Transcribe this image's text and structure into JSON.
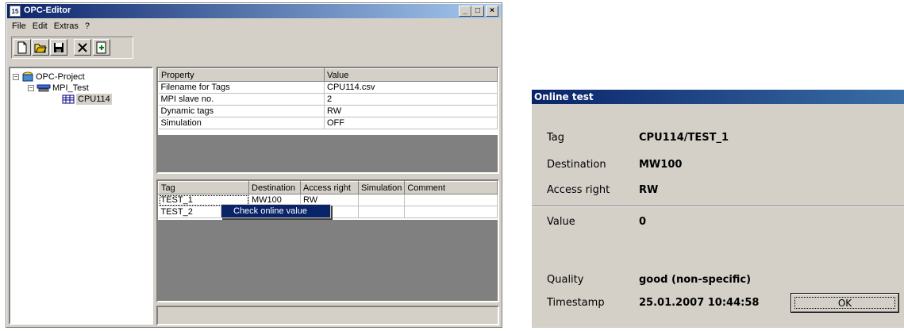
{
  "editor": {
    "title": "OPC-Editor",
    "app_icon_text": "15",
    "menu": [
      "File",
      "Edit",
      "Extras",
      "?"
    ],
    "tree": {
      "root": "OPC-Project",
      "child": "MPI_Test",
      "leaf": "CPU114"
    },
    "property_table": {
      "headers": [
        "Property",
        "Value"
      ],
      "rows": [
        [
          "Filename for Tags",
          "CPU114.csv"
        ],
        [
          "MPI slave no.",
          "2"
        ],
        [
          "Dynamic tags",
          "RW"
        ],
        [
          "Simulation",
          "OFF"
        ]
      ]
    },
    "tag_table": {
      "headers": [
        "Tag",
        "Destination",
        "Access right",
        "Simulation",
        "Comment"
      ],
      "rows": [
        [
          "TEST_1",
          "MW100",
          "RW",
          "",
          ""
        ],
        [
          "TEST_2",
          "",
          "",
          "",
          ""
        ]
      ]
    },
    "context_menu": "Check online value"
  },
  "dialog": {
    "title": "Online test",
    "tag_label": "Tag",
    "tag_value": "CPU114/TEST_1",
    "destination_label": "Destination",
    "destination_value": "MW100",
    "access_label": "Access right",
    "access_value": "RW",
    "value_label": "Value",
    "value_value": "0",
    "quality_label": "Quality",
    "quality_value": "good (non-specific)",
    "timestamp_label": "Timestamp",
    "timestamp_value": "25.01.2007 10:44:58",
    "ok_label": "OK"
  }
}
